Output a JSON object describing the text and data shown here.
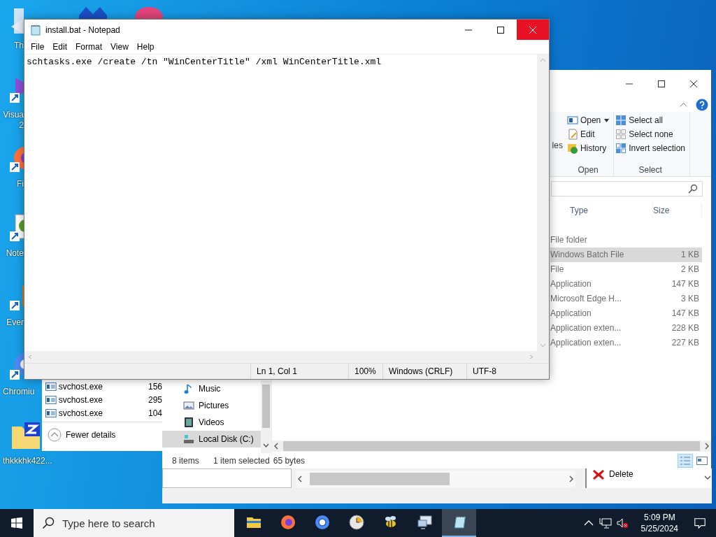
{
  "desktop_icons": [
    {
      "kind": "shortcut-doc",
      "label": [
        "Th"
      ]
    },
    {
      "kind": "blue-app"
    },
    {
      "kind": "pink-app"
    },
    {
      "kind": "vs",
      "label": [
        "Visua",
        "2"
      ]
    },
    {
      "kind": "firefox",
      "label": [
        "Fi"
      ]
    },
    {
      "kind": "notepad-app",
      "label": [
        "Note"
      ]
    },
    {
      "kind": "evernote",
      "label": [
        "Ever"
      ]
    },
    {
      "kind": "chromium",
      "label": [
        "Chromiu"
      ]
    },
    {
      "kind": "zip-folder",
      "label": [
        "thkkkhk422..."
      ]
    }
  ],
  "task_manager": {
    "rows": [
      {
        "name": "svchost.exe",
        "value": "156"
      },
      {
        "name": "svchost.exe",
        "value": "295"
      },
      {
        "name": "svchost.exe",
        "value": "104"
      }
    ],
    "toggle": "Fewer details"
  },
  "explorer": {
    "ribbon": {
      "cut_label": "les",
      "groups": [
        {
          "label": "Open",
          "items": [
            {
              "kind": "open",
              "label": "Open",
              "dropdown": true
            },
            {
              "kind": "edit",
              "label": "Edit",
              "dropdown": false
            },
            {
              "kind": "history",
              "label": "History",
              "dropdown": false
            }
          ]
        },
        {
          "label": "Select",
          "items": [
            {
              "kind": "select-all",
              "label": "Select all",
              "dropdown": false
            },
            {
              "kind": "select-none",
              "label": "Select none",
              "dropdown": false
            },
            {
              "kind": "invert",
              "label": "Invert selection",
              "dropdown": false
            }
          ]
        }
      ]
    },
    "columns": [
      "Type",
      "Size"
    ],
    "rows": [
      {
        "type": "File folder",
        "selected": false
      },
      {
        "type": "Windows Batch File",
        "size": "1 KB",
        "selected": true
      },
      {
        "type": "File",
        "size": "2 KB",
        "selected": false
      },
      {
        "type": "Application",
        "size": "147 KB",
        "selected": false
      },
      {
        "type": "Microsoft Edge H...",
        "size": "3 KB",
        "selected": false
      },
      {
        "type": "Application",
        "size": "147 KB",
        "selected": false
      },
      {
        "type": "Application exten...",
        "size": "228 KB",
        "selected": false
      },
      {
        "type": "Application exten...",
        "size": "227 KB",
        "selected": false
      }
    ],
    "nav": [
      {
        "kind": "music",
        "label": "Music",
        "selected": false
      },
      {
        "kind": "pictures",
        "label": "Pictures",
        "selected": false
      },
      {
        "kind": "videos",
        "label": "Videos",
        "selected": false
      },
      {
        "kind": "drive",
        "label": "Local Disk (C:)",
        "selected": true
      }
    ],
    "status": {
      "count": "8 items",
      "selection": "1 item selected",
      "size": "65 bytes"
    },
    "view_modes": [
      {
        "kind": "details",
        "selected": true
      },
      {
        "kind": "large",
        "selected": false
      }
    ]
  },
  "back_window": {
    "items": [
      {
        "kind": "delete",
        "label": "Delete"
      }
    ]
  },
  "notepad": {
    "title": "install.bat - Notepad",
    "menu": [
      "File",
      "Edit",
      "Format",
      "View",
      "Help"
    ],
    "content": "schtasks.exe /create /tn \"WinCenterTitle\" /xml WinCenterTitle.xml",
    "close_hovered": true,
    "status": [
      "Ln 1, Col 1",
      "100%",
      "Windows (CRLF)",
      "UTF-8"
    ]
  },
  "taskbar": {
    "search": {
      "placeholder": "Type here to search"
    },
    "apps": [
      {
        "kind": "folder",
        "active": false
      },
      {
        "kind": "firefox",
        "active": false
      },
      {
        "kind": "chromium",
        "active": false
      },
      {
        "kind": "clock",
        "active": false
      },
      {
        "kind": "bee",
        "active": false
      },
      {
        "kind": "remote",
        "active": false
      },
      {
        "kind": "notepad",
        "active": true
      }
    ],
    "time": "5:09 PM",
    "date": "5/25/2024"
  }
}
